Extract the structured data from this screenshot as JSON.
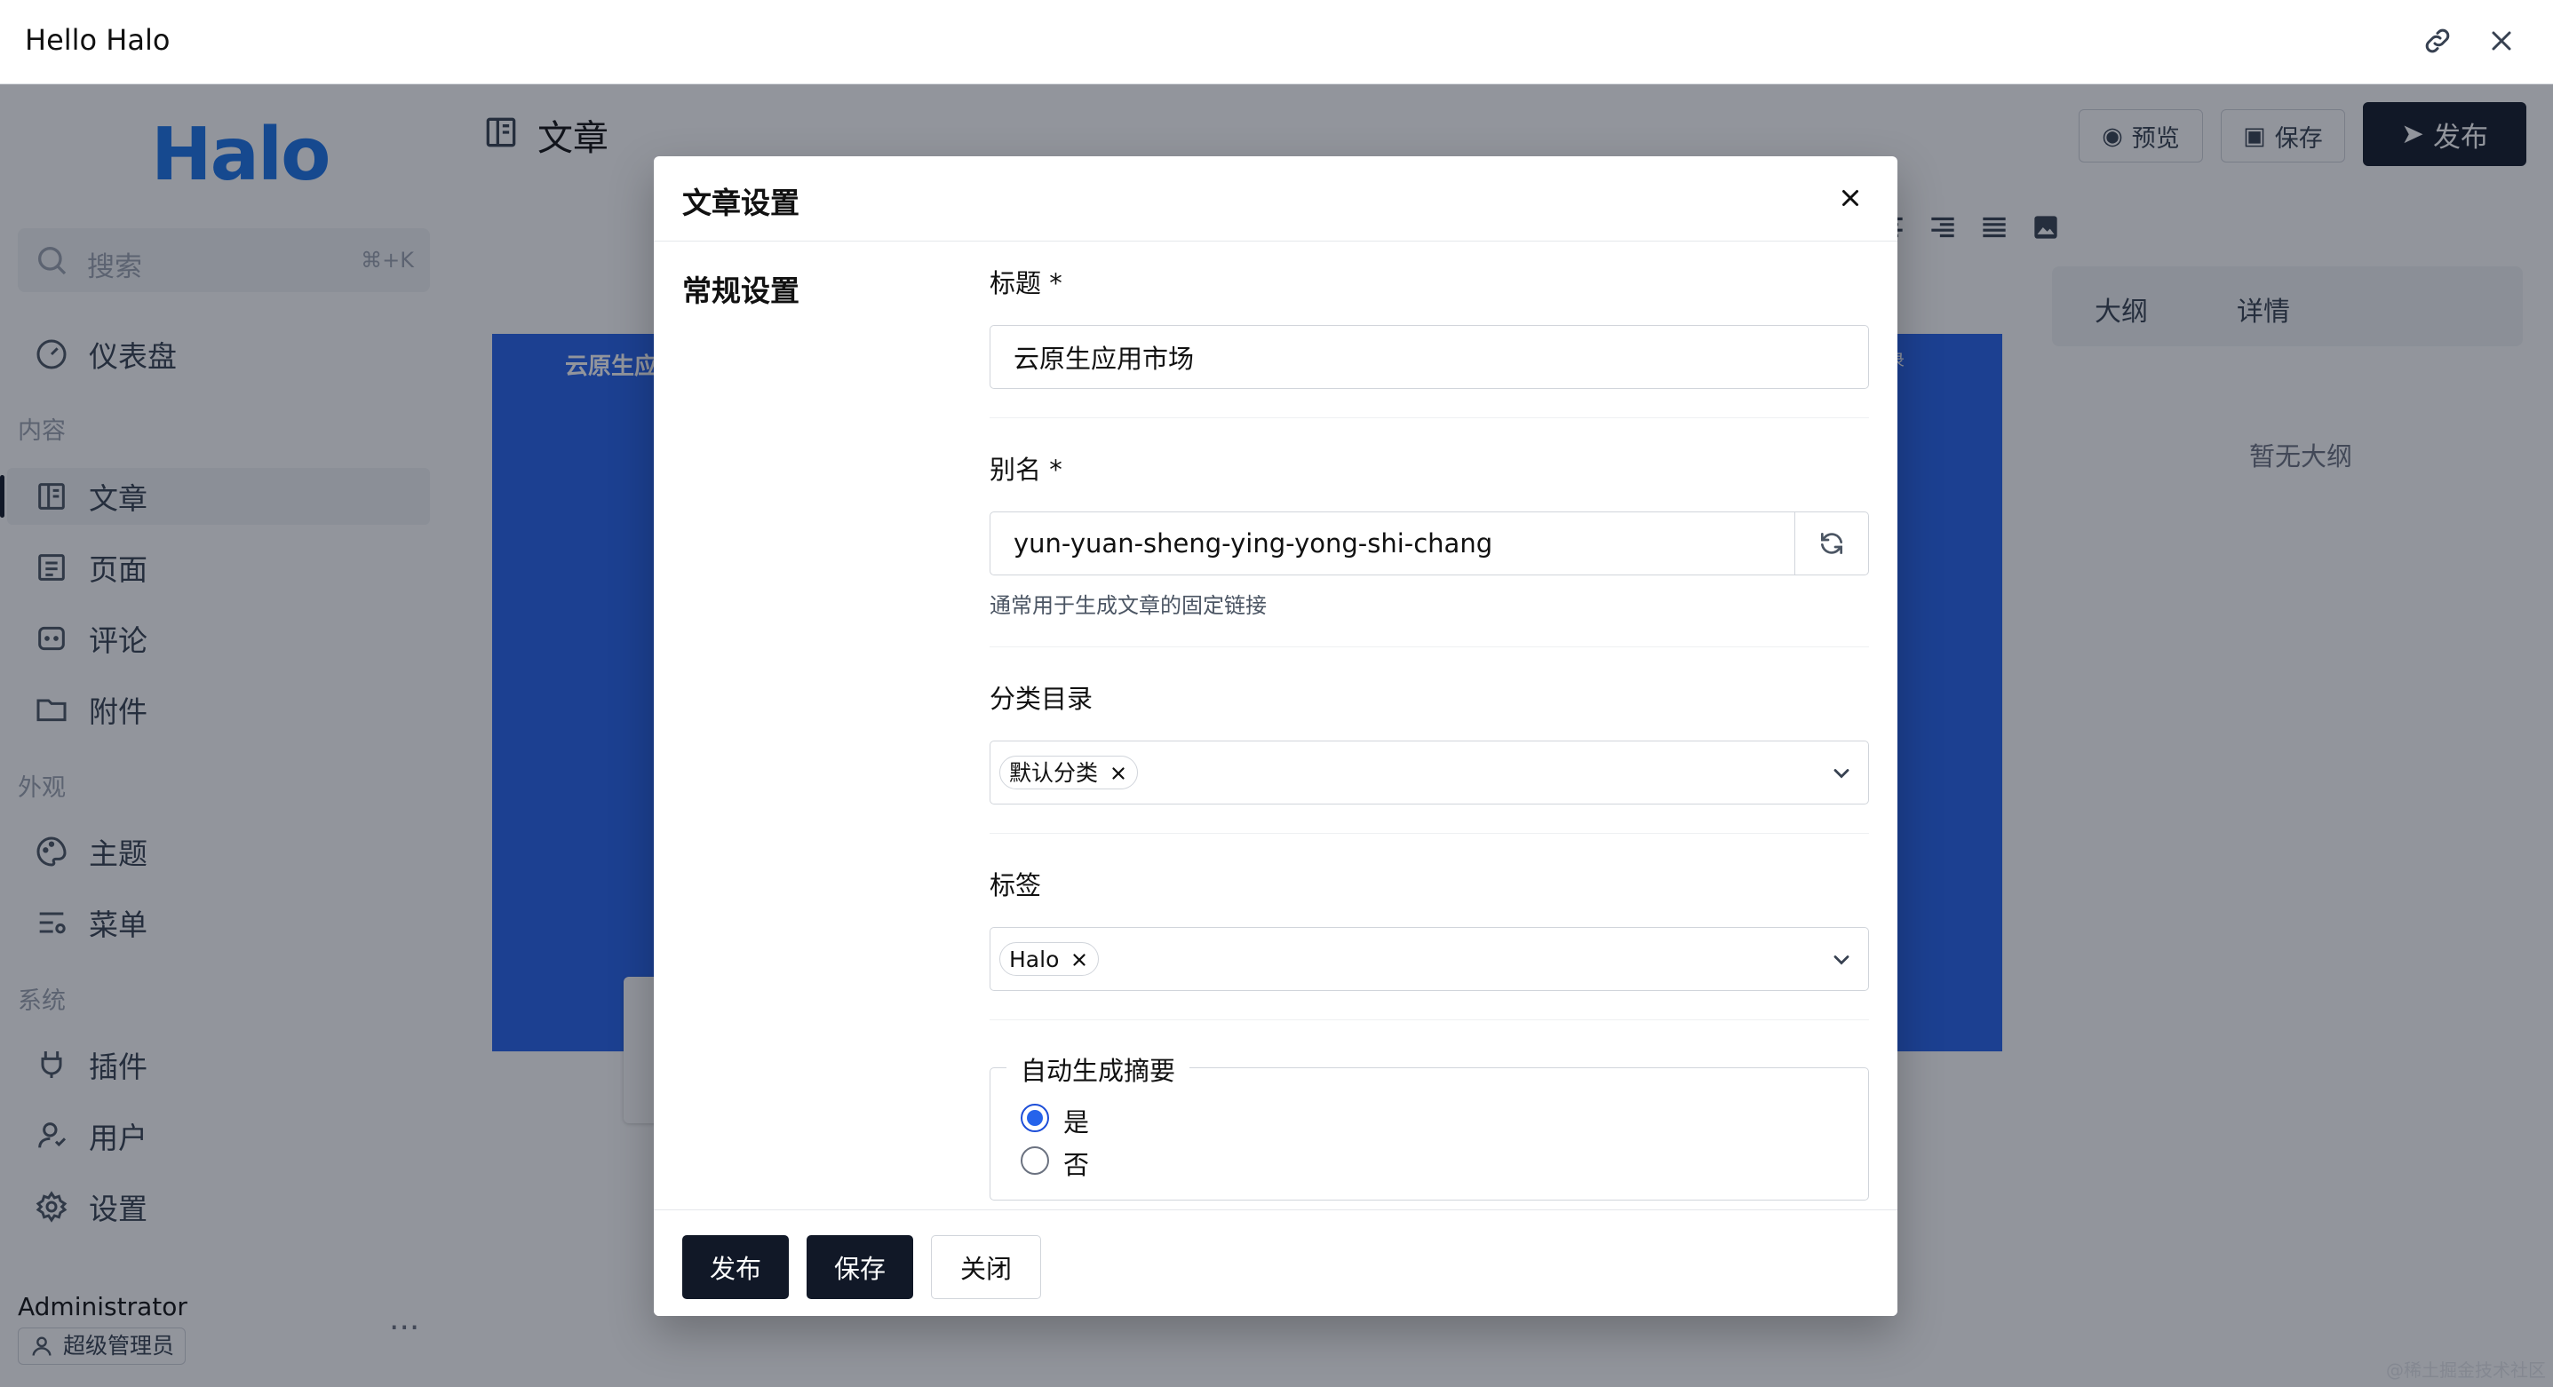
{
  "window": {
    "title": "Hello Halo",
    "link_icon": "link-icon",
    "close_icon": "close-icon"
  },
  "sidebar": {
    "logo": "Halo",
    "search": {
      "placeholder": "搜索",
      "shortcut": "⌘+K"
    },
    "dashboard": "仪表盘",
    "groups": {
      "content": "内容",
      "appearance": "外观",
      "system": "系统"
    },
    "items": [
      {
        "label": "文章",
        "icon": "article-icon",
        "active": true
      },
      {
        "label": "页面",
        "icon": "page-icon"
      },
      {
        "label": "评论",
        "icon": "comment-icon"
      },
      {
        "label": "附件",
        "icon": "folder-icon"
      },
      {
        "label": "主题",
        "icon": "palette-icon"
      },
      {
        "label": "菜单",
        "icon": "menu-icon"
      },
      {
        "label": "插件",
        "icon": "plug-icon"
      },
      {
        "label": "用户",
        "icon": "user-icon"
      },
      {
        "label": "设置",
        "icon": "gear-icon"
      }
    ],
    "user": {
      "name": "Administrator",
      "role": "超级管理员"
    }
  },
  "editor": {
    "title": "文章",
    "preview": "预览",
    "save": "保存",
    "publish": "发布",
    "canvas_title": "云原生应",
    "canvas_right": "登录",
    "outline_tab": "大纲",
    "details_tab": "详情",
    "outline_empty": "暂无大纲",
    "watermark": "@稀土掘金技术社区"
  },
  "modal": {
    "title": "文章设置",
    "section": "常规设置",
    "fields": {
      "title_label": "标题 *",
      "title_value": "云原生应用市场",
      "slug_label": "别名 *",
      "slug_value": "yun-yuan-sheng-ying-yong-shi-chang",
      "slug_help": "通常用于生成文章的固定链接",
      "category_label": "分类目录",
      "category_chip": "默认分类",
      "tags_label": "标签",
      "tag_chip": "Halo",
      "excerpt_legend": "自动生成摘要",
      "excerpt_yes": "是",
      "excerpt_no": "否",
      "excerpt_selected": "是"
    },
    "footer": {
      "publish": "发布",
      "save": "保存",
      "close": "关闭"
    }
  },
  "colors": {
    "primary_dark": "#111827",
    "brand_blue": "#1a73e8",
    "radio_blue": "#2563eb"
  }
}
